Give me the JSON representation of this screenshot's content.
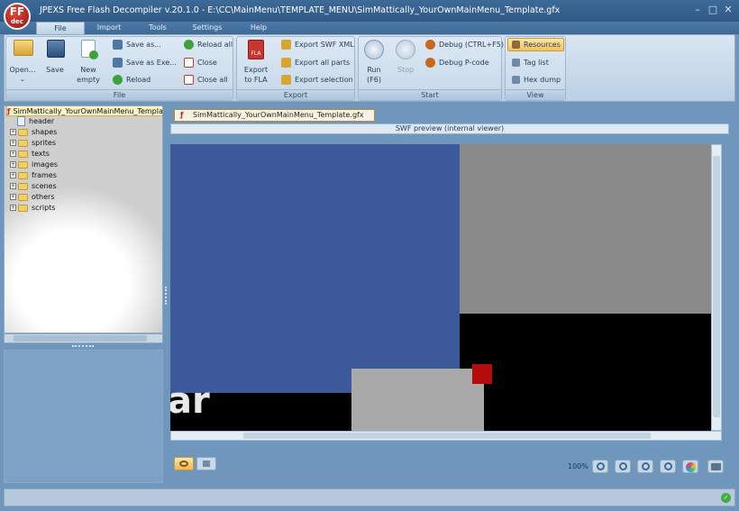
{
  "window": {
    "title": "JPEXS Free Flash Decompiler v.20.1.0 - E:\\CC\\MainMenu\\TEMPLATE_MENU\\SimMattically_YourOwnMainMenu_Template.gfx",
    "logo_top": "FF",
    "logo_bottom": "dec",
    "controls": {
      "minimize": "–",
      "maximize": "□",
      "close": "✕"
    }
  },
  "menu_tabs": [
    "File",
    "Import",
    "Tools",
    "Settings",
    "Help"
  ],
  "ribbon": {
    "file_group": {
      "label": "File",
      "open": "Open...",
      "save": "Save",
      "new_line1": "New",
      "new_line2": "empty",
      "save_as": "Save as...",
      "save_as_exe": "Save as Exe...",
      "reload": "Reload",
      "reload_all": "Reload all",
      "close": "Close",
      "close_all": "Close all"
    },
    "export_group": {
      "label": "Export",
      "export_fla_line1": "Export",
      "export_fla_line2": "to FLA",
      "fla_badge": "FLA",
      "export_swf_xml": "Export SWF XML",
      "export_all_parts": "Export all parts",
      "export_selection": "Export selection"
    },
    "start_group": {
      "label": "Start",
      "run_line1": "Run",
      "run_line2": "(F6)",
      "stop": "Stop",
      "debug": "Debug (CTRL+F5)",
      "debug_pcode": "Debug P-code"
    },
    "view_group": {
      "label": "View",
      "resources": "Resources",
      "tag_list": "Tag list",
      "hex_dump": "Hex dump"
    }
  },
  "tree": {
    "root": "SimMattically_YourOwnMainMenu_Template",
    "items": [
      "header",
      "shapes",
      "sprites",
      "texts",
      "images",
      "frames",
      "scenes",
      "others",
      "scripts"
    ]
  },
  "document": {
    "tab_label": "SimMattically_YourOwnMainMenu_Template.gfx",
    "preview_label": "SWF preview (internal viewer)",
    "stage_text": "ar",
    "zoom": "100%"
  },
  "colors": {
    "blue_panel": "#3c5a99",
    "stage_gray": "#8a8a8a",
    "black": "#000000",
    "red_square": "#b40c0c",
    "light_gray": "#a9a9a9"
  }
}
